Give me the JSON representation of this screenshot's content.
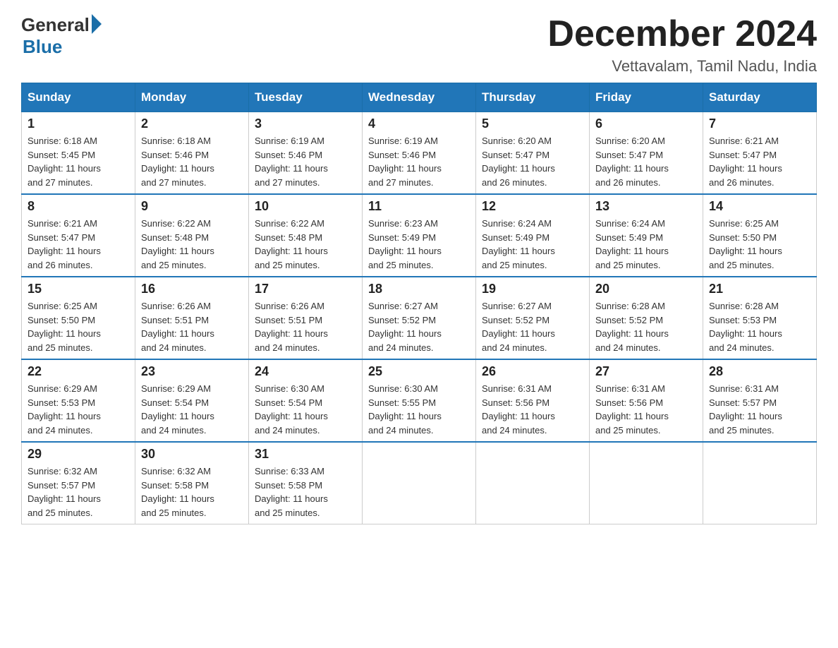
{
  "logo": {
    "general": "General",
    "blue": "Blue"
  },
  "title": "December 2024",
  "location": "Vettavalam, Tamil Nadu, India",
  "days_of_week": [
    "Sunday",
    "Monday",
    "Tuesday",
    "Wednesday",
    "Thursday",
    "Friday",
    "Saturday"
  ],
  "weeks": [
    [
      {
        "day": "1",
        "sunrise": "6:18 AM",
        "sunset": "5:45 PM",
        "daylight": "11 hours and 27 minutes."
      },
      {
        "day": "2",
        "sunrise": "6:18 AM",
        "sunset": "5:46 PM",
        "daylight": "11 hours and 27 minutes."
      },
      {
        "day": "3",
        "sunrise": "6:19 AM",
        "sunset": "5:46 PM",
        "daylight": "11 hours and 27 minutes."
      },
      {
        "day": "4",
        "sunrise": "6:19 AM",
        "sunset": "5:46 PM",
        "daylight": "11 hours and 27 minutes."
      },
      {
        "day": "5",
        "sunrise": "6:20 AM",
        "sunset": "5:47 PM",
        "daylight": "11 hours and 26 minutes."
      },
      {
        "day": "6",
        "sunrise": "6:20 AM",
        "sunset": "5:47 PM",
        "daylight": "11 hours and 26 minutes."
      },
      {
        "day": "7",
        "sunrise": "6:21 AM",
        "sunset": "5:47 PM",
        "daylight": "11 hours and 26 minutes."
      }
    ],
    [
      {
        "day": "8",
        "sunrise": "6:21 AM",
        "sunset": "5:47 PM",
        "daylight": "11 hours and 26 minutes."
      },
      {
        "day": "9",
        "sunrise": "6:22 AM",
        "sunset": "5:48 PM",
        "daylight": "11 hours and 25 minutes."
      },
      {
        "day": "10",
        "sunrise": "6:22 AM",
        "sunset": "5:48 PM",
        "daylight": "11 hours and 25 minutes."
      },
      {
        "day": "11",
        "sunrise": "6:23 AM",
        "sunset": "5:49 PM",
        "daylight": "11 hours and 25 minutes."
      },
      {
        "day": "12",
        "sunrise": "6:24 AM",
        "sunset": "5:49 PM",
        "daylight": "11 hours and 25 minutes."
      },
      {
        "day": "13",
        "sunrise": "6:24 AM",
        "sunset": "5:49 PM",
        "daylight": "11 hours and 25 minutes."
      },
      {
        "day": "14",
        "sunrise": "6:25 AM",
        "sunset": "5:50 PM",
        "daylight": "11 hours and 25 minutes."
      }
    ],
    [
      {
        "day": "15",
        "sunrise": "6:25 AM",
        "sunset": "5:50 PM",
        "daylight": "11 hours and 25 minutes."
      },
      {
        "day": "16",
        "sunrise": "6:26 AM",
        "sunset": "5:51 PM",
        "daylight": "11 hours and 24 minutes."
      },
      {
        "day": "17",
        "sunrise": "6:26 AM",
        "sunset": "5:51 PM",
        "daylight": "11 hours and 24 minutes."
      },
      {
        "day": "18",
        "sunrise": "6:27 AM",
        "sunset": "5:52 PM",
        "daylight": "11 hours and 24 minutes."
      },
      {
        "day": "19",
        "sunrise": "6:27 AM",
        "sunset": "5:52 PM",
        "daylight": "11 hours and 24 minutes."
      },
      {
        "day": "20",
        "sunrise": "6:28 AM",
        "sunset": "5:52 PM",
        "daylight": "11 hours and 24 minutes."
      },
      {
        "day": "21",
        "sunrise": "6:28 AM",
        "sunset": "5:53 PM",
        "daylight": "11 hours and 24 minutes."
      }
    ],
    [
      {
        "day": "22",
        "sunrise": "6:29 AM",
        "sunset": "5:53 PM",
        "daylight": "11 hours and 24 minutes."
      },
      {
        "day": "23",
        "sunrise": "6:29 AM",
        "sunset": "5:54 PM",
        "daylight": "11 hours and 24 minutes."
      },
      {
        "day": "24",
        "sunrise": "6:30 AM",
        "sunset": "5:54 PM",
        "daylight": "11 hours and 24 minutes."
      },
      {
        "day": "25",
        "sunrise": "6:30 AM",
        "sunset": "5:55 PM",
        "daylight": "11 hours and 24 minutes."
      },
      {
        "day": "26",
        "sunrise": "6:31 AM",
        "sunset": "5:56 PM",
        "daylight": "11 hours and 24 minutes."
      },
      {
        "day": "27",
        "sunrise": "6:31 AM",
        "sunset": "5:56 PM",
        "daylight": "11 hours and 25 minutes."
      },
      {
        "day": "28",
        "sunrise": "6:31 AM",
        "sunset": "5:57 PM",
        "daylight": "11 hours and 25 minutes."
      }
    ],
    [
      {
        "day": "29",
        "sunrise": "6:32 AM",
        "sunset": "5:57 PM",
        "daylight": "11 hours and 25 minutes."
      },
      {
        "day": "30",
        "sunrise": "6:32 AM",
        "sunset": "5:58 PM",
        "daylight": "11 hours and 25 minutes."
      },
      {
        "day": "31",
        "sunrise": "6:33 AM",
        "sunset": "5:58 PM",
        "daylight": "11 hours and 25 minutes."
      },
      null,
      null,
      null,
      null
    ]
  ],
  "labels": {
    "sunrise": "Sunrise:",
    "sunset": "Sunset:",
    "daylight": "Daylight:"
  }
}
